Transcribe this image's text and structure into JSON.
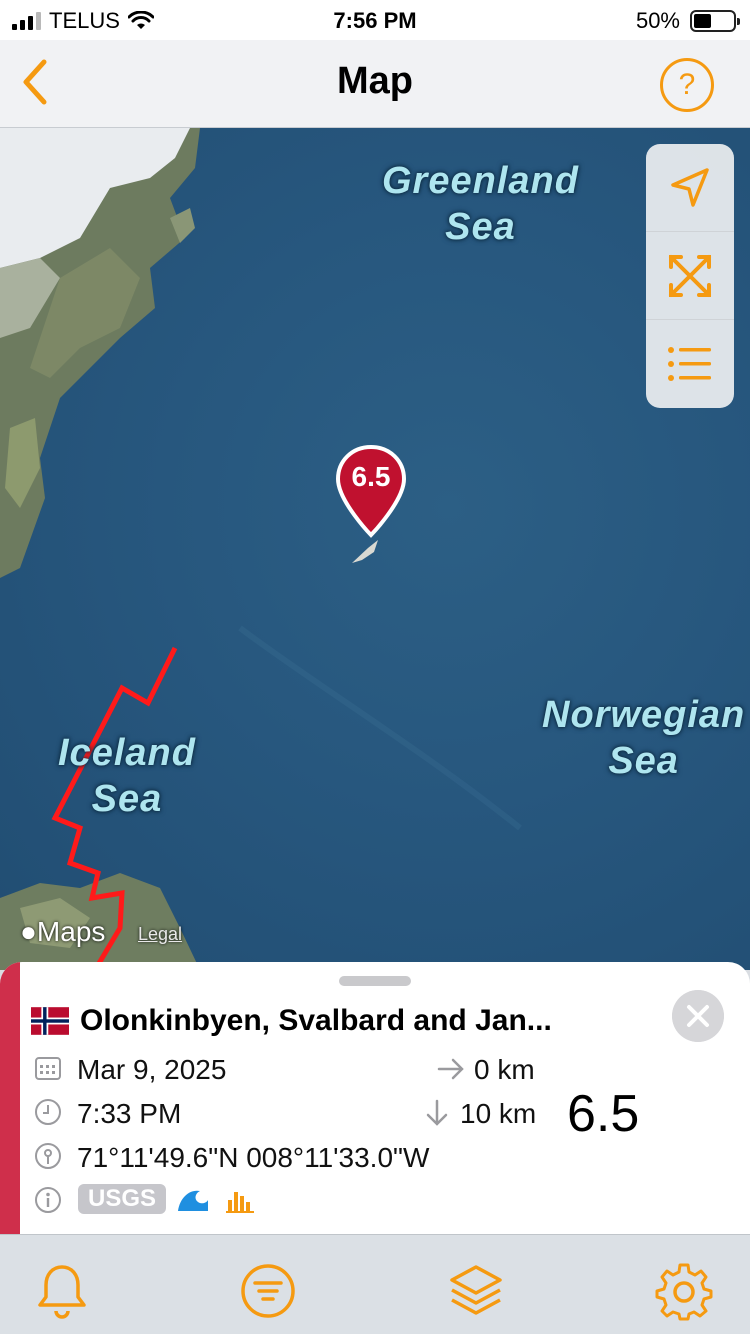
{
  "status_bar": {
    "carrier": "TELUS",
    "time": "7:56 PM",
    "battery": "50%",
    "battery_level": 0.5
  },
  "nav": {
    "title": "Map",
    "back_icon": "chevron-left-icon",
    "help_label": "?"
  },
  "map": {
    "labels": {
      "greenland_sea": "Greenland\nSea",
      "iceland_sea": "Iceland\nSea",
      "norwegian_sea": "Norwegian\nSea"
    },
    "attribution": "Maps",
    "legal": "Legal",
    "controls": [
      "location-arrow-icon",
      "fit-expand-icon",
      "list-icon"
    ],
    "pin_magnitude": "6.5"
  },
  "event": {
    "flag": "norway-flag-icon",
    "place": "Olonkinbyen, Svalbard and Jan...",
    "date": "Mar 9, 2025",
    "time": "7:33 PM",
    "coordinates": "71°11'49.6\"N 008°11'33.0\"W",
    "distance": "0 km",
    "depth": "10 km",
    "magnitude": "6.5",
    "source_badge": "USGS"
  },
  "colors": {
    "accent": "#f59a11",
    "pin": "#c0112f",
    "stripe": "#cf2f4b",
    "fault_line": "#ff1a1a"
  },
  "tabs": [
    "bell-icon",
    "filter-icon",
    "layers-icon",
    "settings-gear-icon"
  ]
}
